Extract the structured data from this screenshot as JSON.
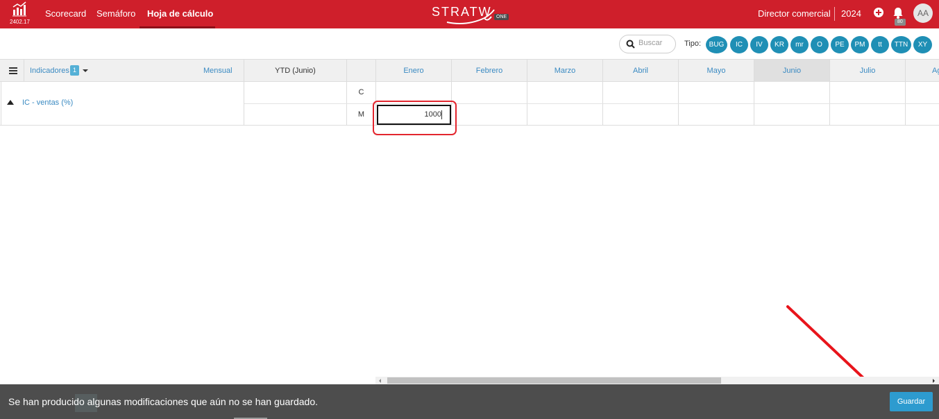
{
  "topbar": {
    "version": "2402.17",
    "nav": [
      {
        "label": "Scorecard"
      },
      {
        "label": "Semáforo"
      },
      {
        "label": "Hoja de cálculo",
        "active": true
      }
    ],
    "brand": "STRATW",
    "brand_sub": "ONE",
    "role": "Director comercial",
    "year": "2024",
    "notifications": "80",
    "avatar": "AA",
    "accent": "#cf1f2b"
  },
  "filters": {
    "search_placeholder": "Buscar",
    "tipo_label": "Tipo:",
    "types": [
      "BUG",
      "IC",
      "IV",
      "KR",
      "mr",
      "O",
      "PE",
      "PM",
      "tt",
      "TTN",
      "XY"
    ],
    "chip_color": "#1f8fb5"
  },
  "grid": {
    "indicadores_label": "Indicadores",
    "indicadores_count": "1",
    "frequency": "Mensual",
    "ytd": "YTD (Junio)",
    "months": [
      "Enero",
      "Febrero",
      "Marzo",
      "Abril",
      "Mayo",
      "Junio",
      "Julio",
      "Ag"
    ],
    "current_month": "Junio",
    "rows": [
      {
        "indicator": "IC - ventas (%)",
        "codes": [
          "C",
          "M"
        ],
        "editing_value": "1000"
      }
    ]
  },
  "savebar": {
    "message": "Se han producido algunas modificaciones que aún no se han guardado.",
    "save_label": "Guardar",
    "button_color": "#2d9bcf"
  }
}
